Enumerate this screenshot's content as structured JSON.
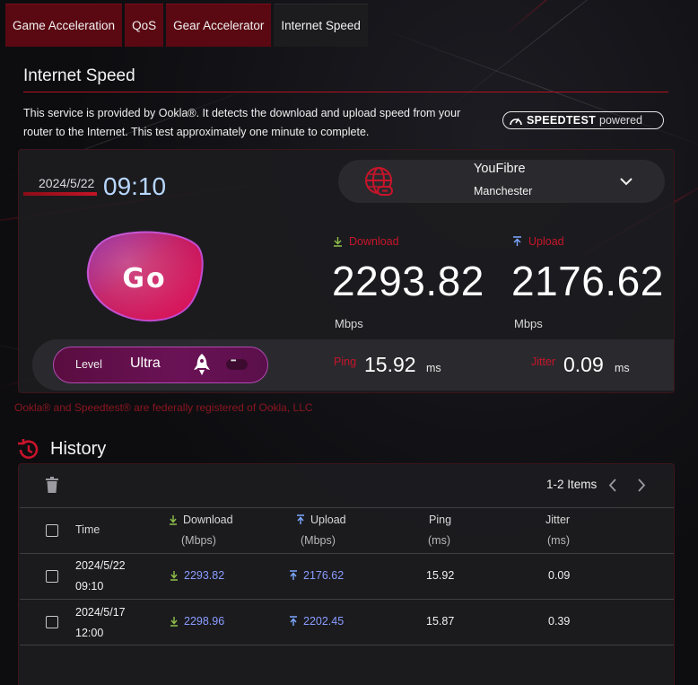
{
  "tabs": [
    {
      "label": "Game Acceleration"
    },
    {
      "label": "QoS"
    },
    {
      "label": "Gear Accelerator"
    },
    {
      "label": "Internet Speed",
      "active": true
    }
  ],
  "header": {
    "title": "Internet Speed",
    "description": "This service is provided by Ookla®. It detects the download and upload speed from your router to the Internet. This test approximately one minute to complete.",
    "badge": {
      "brand": "SPEEDTEST",
      "suffix": "powered"
    }
  },
  "test": {
    "date": "2024/5/22",
    "time": "09:10",
    "server": {
      "isp": "YouFibre",
      "city": "Manchester"
    },
    "go_label": "Go",
    "download": {
      "label": "Download",
      "value": "2293.82",
      "unit": "Mbps"
    },
    "upload": {
      "label": "Upload",
      "value": "2176.62",
      "unit": "Mbps"
    },
    "level": {
      "label": "Level",
      "value": "Ultra"
    },
    "ping": {
      "label": "Ping",
      "value": "15.92",
      "unit": "ms"
    },
    "jitter": {
      "label": "Jitter",
      "value": "0.09",
      "unit": "ms"
    }
  },
  "ookla_note": "Ookla® and Speedtest® are federally registered of Ookla, LLC",
  "history": {
    "title": "History",
    "items_count": "1-2 Items",
    "columns": {
      "time": "Time",
      "download": "Download",
      "download_unit": "(Mbps)",
      "upload": "Upload",
      "upload_unit": "(Mbps)",
      "ping": "Ping",
      "ping_unit": "(ms)",
      "jitter": "Jitter",
      "jitter_unit": "(ms)"
    },
    "rows": [
      {
        "date": "2024/5/22",
        "time": "09:10",
        "download": "2293.82",
        "upload": "2176.62",
        "ping": "15.92",
        "jitter": "0.09"
      },
      {
        "date": "2024/5/17",
        "time": "12:00",
        "download": "2298.96",
        "upload": "2202.45",
        "ping": "15.87",
        "jitter": "0.39"
      }
    ]
  },
  "colors": {
    "accent_red": "#c8142a",
    "link_blue": "#8a9cff",
    "time_blue": "#b8d7ff",
    "level_purple": "#6a1256"
  }
}
